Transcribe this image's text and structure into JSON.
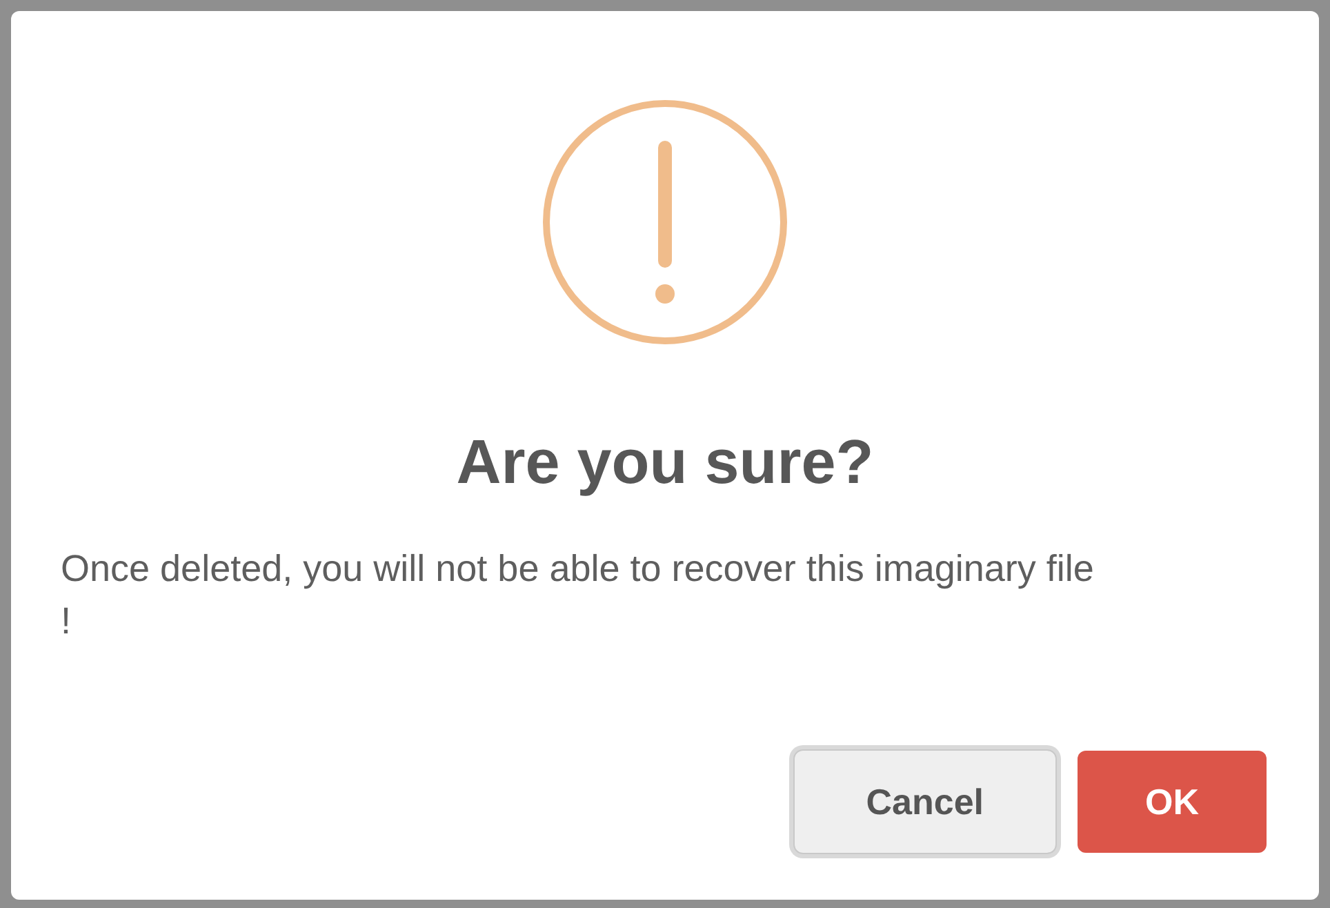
{
  "dialog": {
    "title": "Are you sure?",
    "message": "Once deleted, you will not be able to recover this imaginary file !",
    "buttons": [
      {
        "label": "Cancel",
        "kind": "cancel",
        "focused": true
      },
      {
        "label": "OK",
        "kind": "confirm",
        "focused": false
      }
    ]
  }
}
